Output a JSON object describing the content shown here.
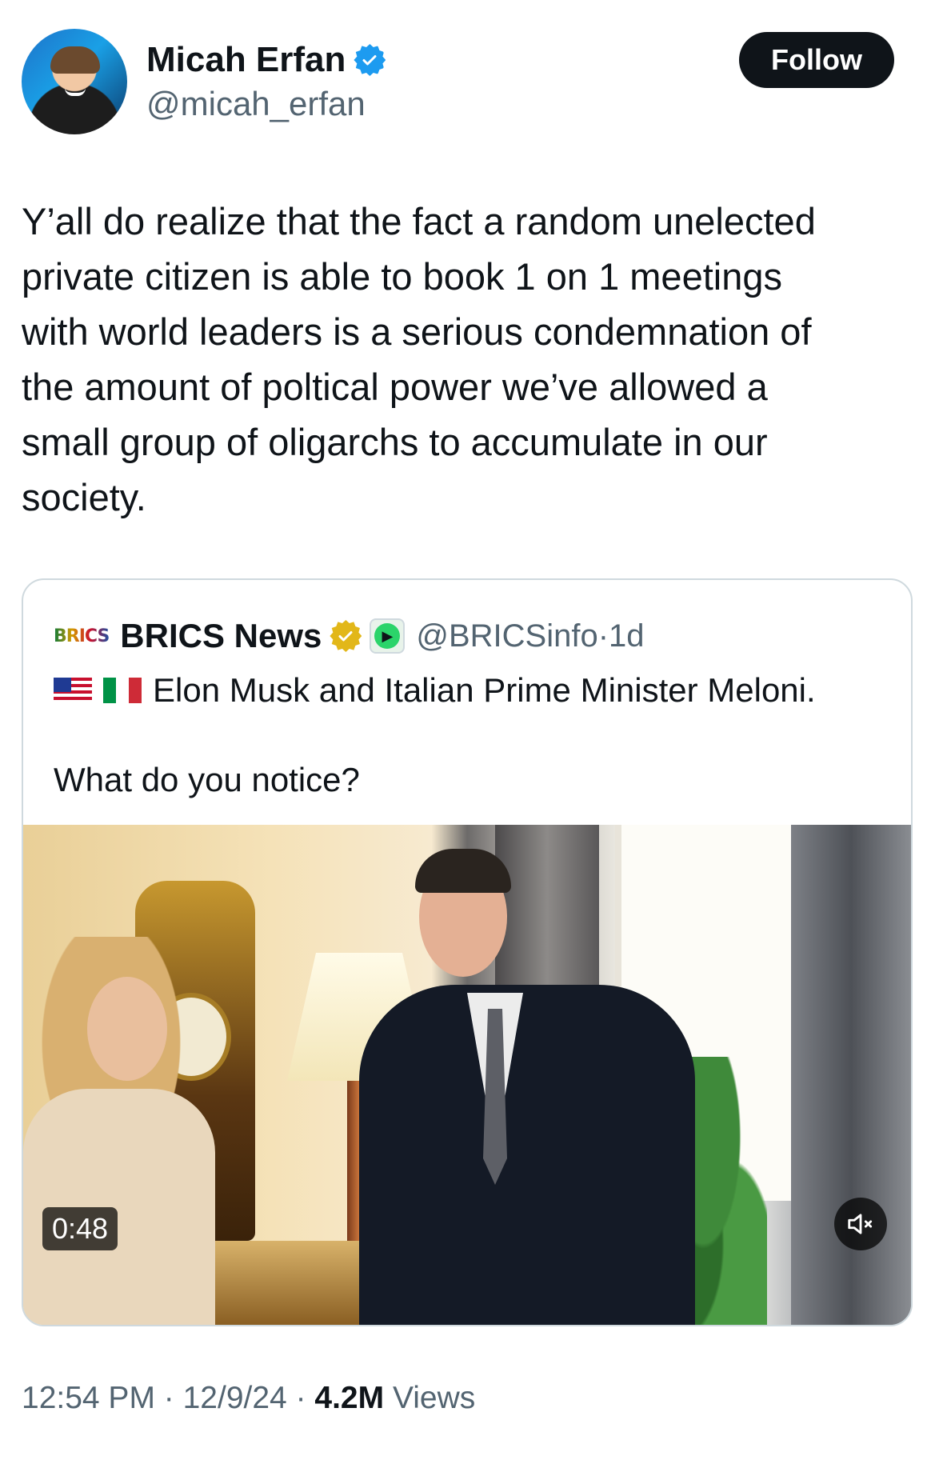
{
  "author": {
    "display_name": "Micah Erfan",
    "handle": "@micah_erfan",
    "verified": true,
    "avatar_icon": "profile-photo"
  },
  "follow_button": {
    "label": "Follow"
  },
  "tweet": {
    "lines": [
      "Y’all do realize that the fact a random unelected",
      "private citizen is able to book 1 on 1 meetings",
      "with world leaders is a serious condemnation of",
      "the amount of poltical power we’ve allowed a",
      "small group of oligarchs to accumulate in our",
      "society."
    ]
  },
  "quote": {
    "logo_text": "BRICS",
    "display_name": "BRICS News",
    "handle": "@BRICSinfo",
    "separator": "·",
    "time": "1d",
    "badges": [
      "gold-verified-icon",
      "affiliate-badge-icon"
    ],
    "flags": [
      "us-flag-icon",
      "italy-flag-icon"
    ],
    "line1": "Elon Musk and Italian Prime Minister Meloni.",
    "line2": "What do you notice?",
    "video": {
      "duration": "0:48",
      "muted": true,
      "mute_icon": "speaker-muted-icon"
    }
  },
  "meta": {
    "time": "12:54 PM",
    "sep1": " · ",
    "date": "12/9/24",
    "sep2": " · ",
    "views_count": "4.2M",
    "views_label": " Views"
  },
  "colors": {
    "text_primary": "#0f1419",
    "text_secondary": "#536471",
    "verified_blue": "#1d9bf0",
    "verified_gold": "#e2b719",
    "border": "#cfd9de"
  }
}
